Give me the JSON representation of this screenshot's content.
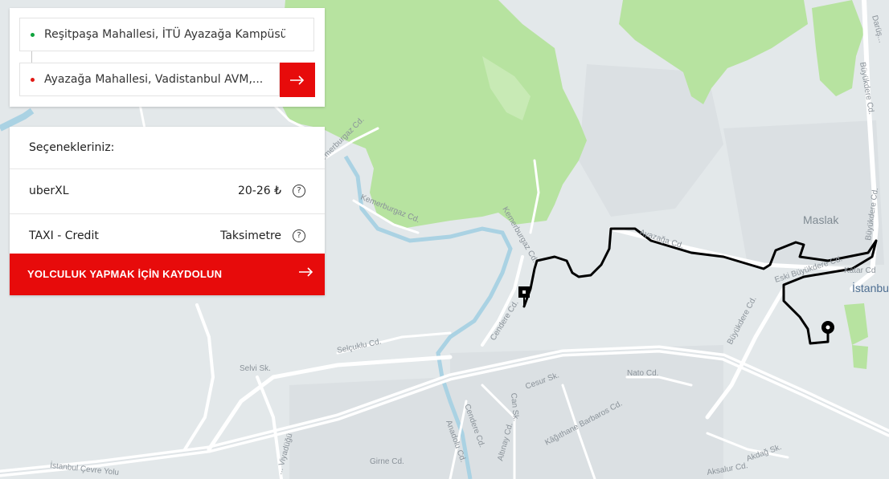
{
  "route": {
    "pickup": "Reşitpaşa Mahallesi, İTÜ Ayazağa Kampüsü,...",
    "dropoff": "Ayazağa Mahallesi, Vadistanbul AVM,..."
  },
  "options": {
    "header": "Seçenekleriniz:",
    "items": [
      {
        "name": "uberXL",
        "price": "20-26 ₺"
      },
      {
        "name": "TAXI - Credit",
        "price": "Taksimetre"
      }
    ],
    "cta_label": "YOLCULUK YAPMAK İÇİN KAYDOLUN"
  },
  "map": {
    "labels": {
      "kemerburgaz_1": "Kemerburgaz Cd.",
      "kemerburgaz_2": "Kemerburgaz Cd.",
      "kemerburgaz_3": "Kemerburgaz Cd.",
      "ayazaga": "Ayazağa Cd.",
      "eski_buyukdere": "Eski Büyükdere Cd.",
      "buyukdere_1": "Büyükdere Cd.",
      "buyukdere_2": "Büyükdere Cd.",
      "maslak": "Maslak",
      "katar": "Katar Cd",
      "istanbul_teknik": "İstanbul Teknik Üniversitesi",
      "cendere_1": "Cendere Cd.",
      "cendere_2": "Cendere Cd.",
      "selcuklu": "Selçuklu Cd.",
      "selvi": "Selvi Sk.",
      "nato": "Nato Cd.",
      "cesur": "Cesur Sk.",
      "can": "Can Sk.",
      "altinay": "Altınay Cd.",
      "kagithane_barbaros": "Kâğıthane Barbaros Cd.",
      "anadolu": "Anadolu Cd.",
      "girne": "Girne Cd.",
      "akdag": "Akdağ Sk.",
      "aksalur": "Aksalur Cd.",
      "cevre_yolu": "İstanbul Çevre Yolu",
      "viyadugu": "... Viyadüğü",
      "darussafaka": "Darüş...",
      "buyukdere_top": "Büyükdere Cd."
    },
    "colors": {
      "park": "#b7e3a0",
      "water": "#aad2e3",
      "road": "#ffffff",
      "route": "#000000"
    }
  }
}
